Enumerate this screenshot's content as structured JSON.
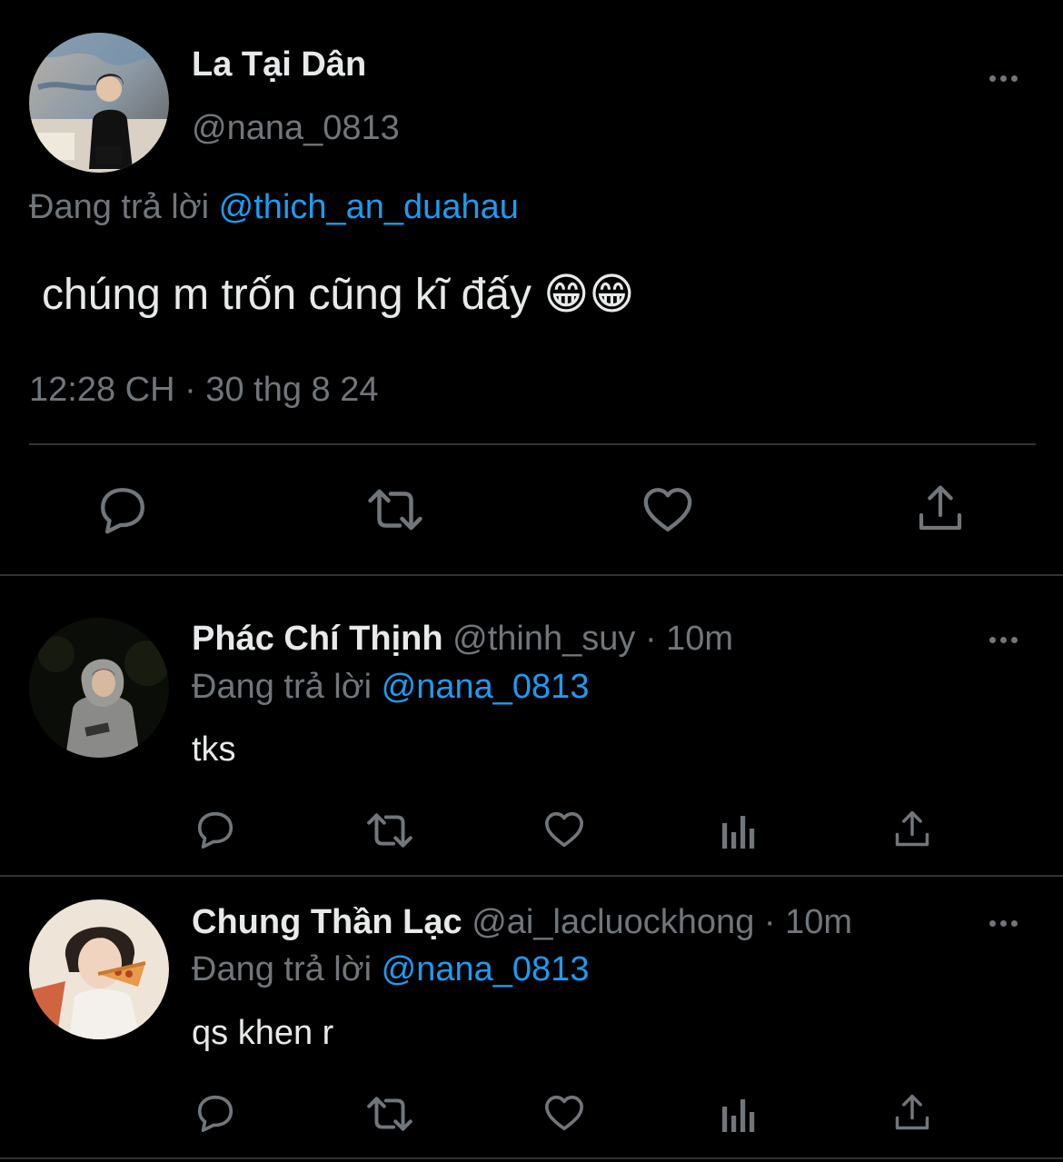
{
  "main_tweet": {
    "display_name": "La Tại Dân",
    "handle": "@nana_0813",
    "reply_prefix": "Đang trả lời",
    "reply_to": "@thich_an_duahau",
    "text": "chúng m trốn cũng kĩ đấy 😁😁",
    "timestamp": "12:28 CH · 30 thg 8 24",
    "actions": [
      "reply-icon",
      "retweet-icon",
      "like-icon",
      "share-icon"
    ]
  },
  "replies": [
    {
      "display_name": "Phác Chí Thịnh",
      "handle": "@thinh_suy",
      "time": "· 10m",
      "reply_prefix": "Đang trả lời",
      "reply_to": "@nana_0813",
      "text": "tks",
      "actions": [
        "reply-icon",
        "retweet-icon",
        "like-icon",
        "views-icon",
        "share-icon"
      ]
    },
    {
      "display_name": "Chung Thần Lạc",
      "handle": "@ai_lacluockhong",
      "time": "· 10m",
      "reply_prefix": "Đang trả lời",
      "reply_to": "@nana_0813",
      "text": "qs khen r",
      "actions": [
        "reply-icon",
        "retweet-icon",
        "like-icon",
        "views-icon",
        "share-icon"
      ]
    }
  ],
  "colors": {
    "background": "#000000",
    "text": "#e7e9ea",
    "muted": "#71767b",
    "link": "#1d9bf0",
    "divider": "#2f3336"
  }
}
